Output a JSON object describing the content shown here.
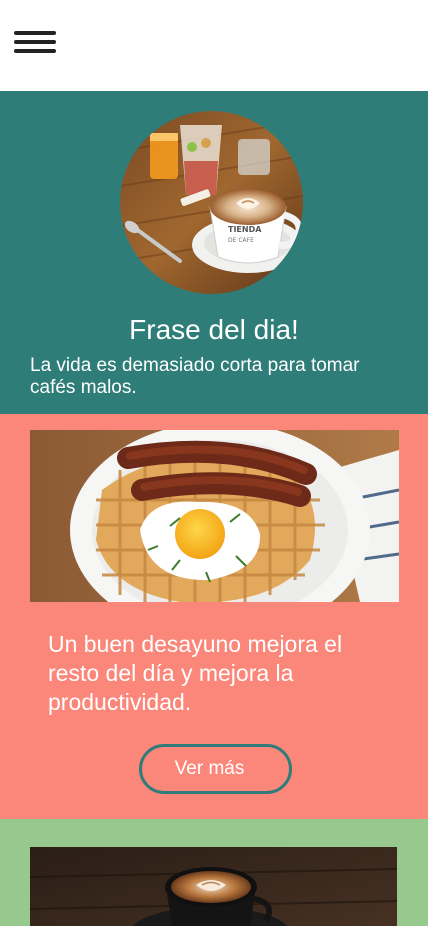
{
  "header": {
    "menu_icon": "hamburger-menu-icon"
  },
  "quote": {
    "photo": "coffee-table-photo",
    "cup_brand_line1": "TIENDA",
    "cup_brand_line2": "DE CAFE",
    "title": "Frase del dia!",
    "text": "La vida es demasiado corta para tomar cafés malos."
  },
  "breakfast": {
    "photo": "waffle-breakfast-photo",
    "text": "Un buen desayuno mejora el resto del día y mejora la productividad.",
    "button_label": "Ver más"
  },
  "coffee": {
    "photo": "latte-art-photo"
  },
  "colors": {
    "teal": "#2e7d78",
    "salmon": "#fb867a",
    "green": "#97c98e",
    "white": "#ffffff"
  }
}
